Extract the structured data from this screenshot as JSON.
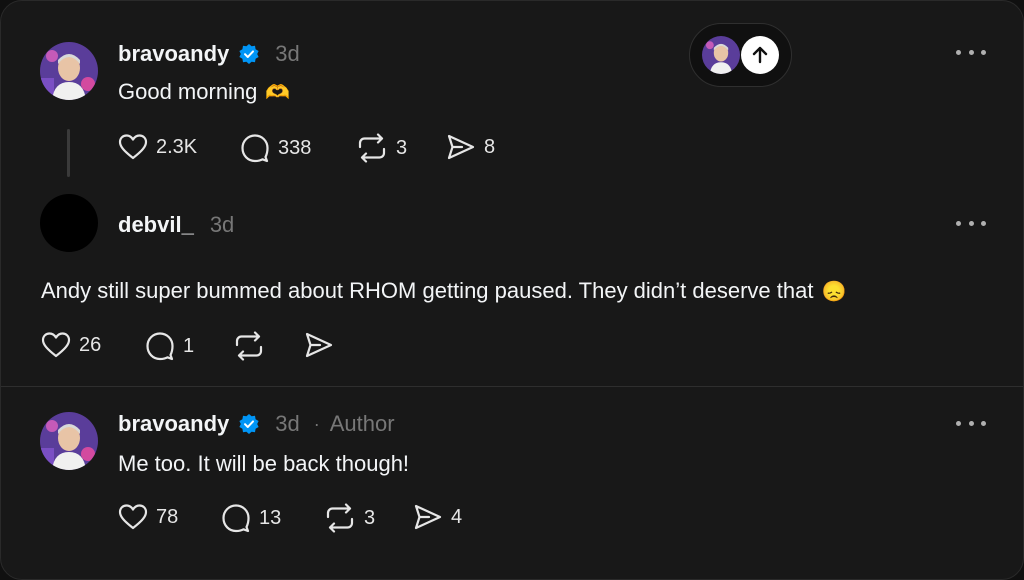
{
  "posts": [
    {
      "username": "bravoandy",
      "verified": true,
      "time": "3d",
      "text": "Good morning",
      "emoji": "🫶",
      "likes": "2.3K",
      "replies": "338",
      "reposts": "3",
      "shares": "8"
    },
    {
      "username": "debvil_",
      "verified": false,
      "time": "3d",
      "text": "Andy still super bummed about RHOM getting paused. They didn’t deserve that",
      "emoji": "😞",
      "likes": "26",
      "replies": "1",
      "reposts": "",
      "shares": ""
    },
    {
      "username": "bravoandy",
      "verified": true,
      "time": "3d",
      "separator": "·",
      "badge": "Author",
      "text": "Me too. It will be back though!",
      "likes": "78",
      "replies": "13",
      "reposts": "3",
      "shares": "4"
    }
  ],
  "colors": {
    "background": "#181818",
    "text": "#f3f5f7",
    "muted": "#777777",
    "verified": "#0095f6"
  },
  "icons": [
    "heart-icon",
    "comment-icon",
    "repost-icon",
    "share-icon",
    "more-icon",
    "arrow-up-icon",
    "verified-badge-icon"
  ]
}
